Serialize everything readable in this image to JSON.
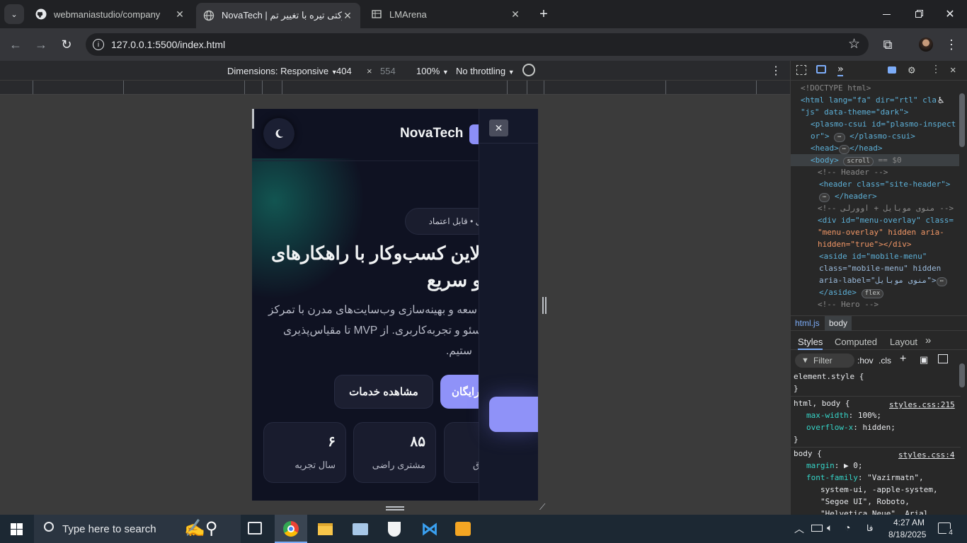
{
  "tabs": [
    {
      "title": "webmaniastudio/company",
      "active": false
    },
    {
      "title": "NovaTech | شرکتی تیره با تغییر تم",
      "active": true
    },
    {
      "title": "LMArena",
      "active": false
    }
  ],
  "address": {
    "url": "127.0.0.1:5500/index.html"
  },
  "device_toolbar": {
    "dimensions_label": "Dimensions: Responsive",
    "width": "404",
    "times": "×",
    "height": "554",
    "zoom": "100%",
    "throttling": "No throttling"
  },
  "site": {
    "brand": "NovaTech",
    "badge": "یتال • قابل اعتماد",
    "headline_1": "لاین کسب‌وکار با راهکارهای",
    "headline_2": "و سریع",
    "para_1": "سعه و بهینه‌سازی وب‌سایت‌های مدرن با تمرکز",
    "para_2": "سئو و تجربه‌کاربری. از MVP تا مقیاس‌پذیری",
    "para_3": "ستیم.",
    "cta_primary": "رایگان",
    "cta_secondary": "مشاهده خدمات",
    "stats": [
      {
        "value": "۶",
        "label": "سال تجربه"
      },
      {
        "value": "۸۵",
        "label": "مشتری راضی"
      },
      {
        "value": "",
        "label": "ق"
      }
    ],
    "close_symbol": "✕"
  },
  "devtools": {
    "dom": [
      "<!DOCTYPE html>",
      "<html lang=\"fa\" dir=\"rtl\" cla",
      "\"js\" data-theme=\"dark\">",
      "<plasmo-csui id=\"plasmo-inspect",
      "or\">",
      "</plasmo-csui>",
      "<head>",
      "</head>",
      "<body>",
      "scroll",
      "== $0",
      "<!-- Header -->",
      "<header class=\"site-header\">",
      "</header>",
      "<!-- منوی موبایل + اوورلی -->",
      "<div id=\"menu-overlay\" class=",
      "\"menu-overlay\" hidden aria-",
      "hidden=\"true\"></div>",
      "<aside id=\"mobile-menu\"",
      "class=\"mobile-menu\" hidden",
      "aria-label=\"منوی موبایل\">",
      "</aside>",
      "flex",
      "<!-- Hero -->"
    ],
    "breadcrumb": [
      "html.js",
      "body"
    ],
    "tabs": [
      "Styles",
      "Computed",
      "Layout"
    ],
    "filter_placeholder": "Filter",
    "hov": ":hov",
    "cls": ".cls",
    "rules": [
      {
        "selector": "element.style {",
        "close": "}"
      },
      {
        "selector": "html, body {",
        "source": "styles.css:215",
        "decls": [
          [
            "max-width",
            "100%;"
          ],
          [
            "overflow-x",
            "hidden;"
          ]
        ],
        "close": "}"
      },
      {
        "selector": "body {",
        "source": "styles.css:4",
        "decls": [
          [
            "margin",
            "▶ 0;"
          ],
          [
            "font-family",
            "\"Vazirmatn\","
          ]
        ],
        "extra": [
          "system-ui, -apple-system,",
          "\"Segoe UI\", Roboto,",
          "\"Helvetica Neue\", Arial,",
          "\"Noto Sans\", \"Apple Color"
        ]
      }
    ]
  },
  "taskbar": {
    "search_placeholder": "Type here to search",
    "time": "4:27 AM",
    "date": "8/18/2025",
    "lang": "فا",
    "notif_count": "4"
  }
}
